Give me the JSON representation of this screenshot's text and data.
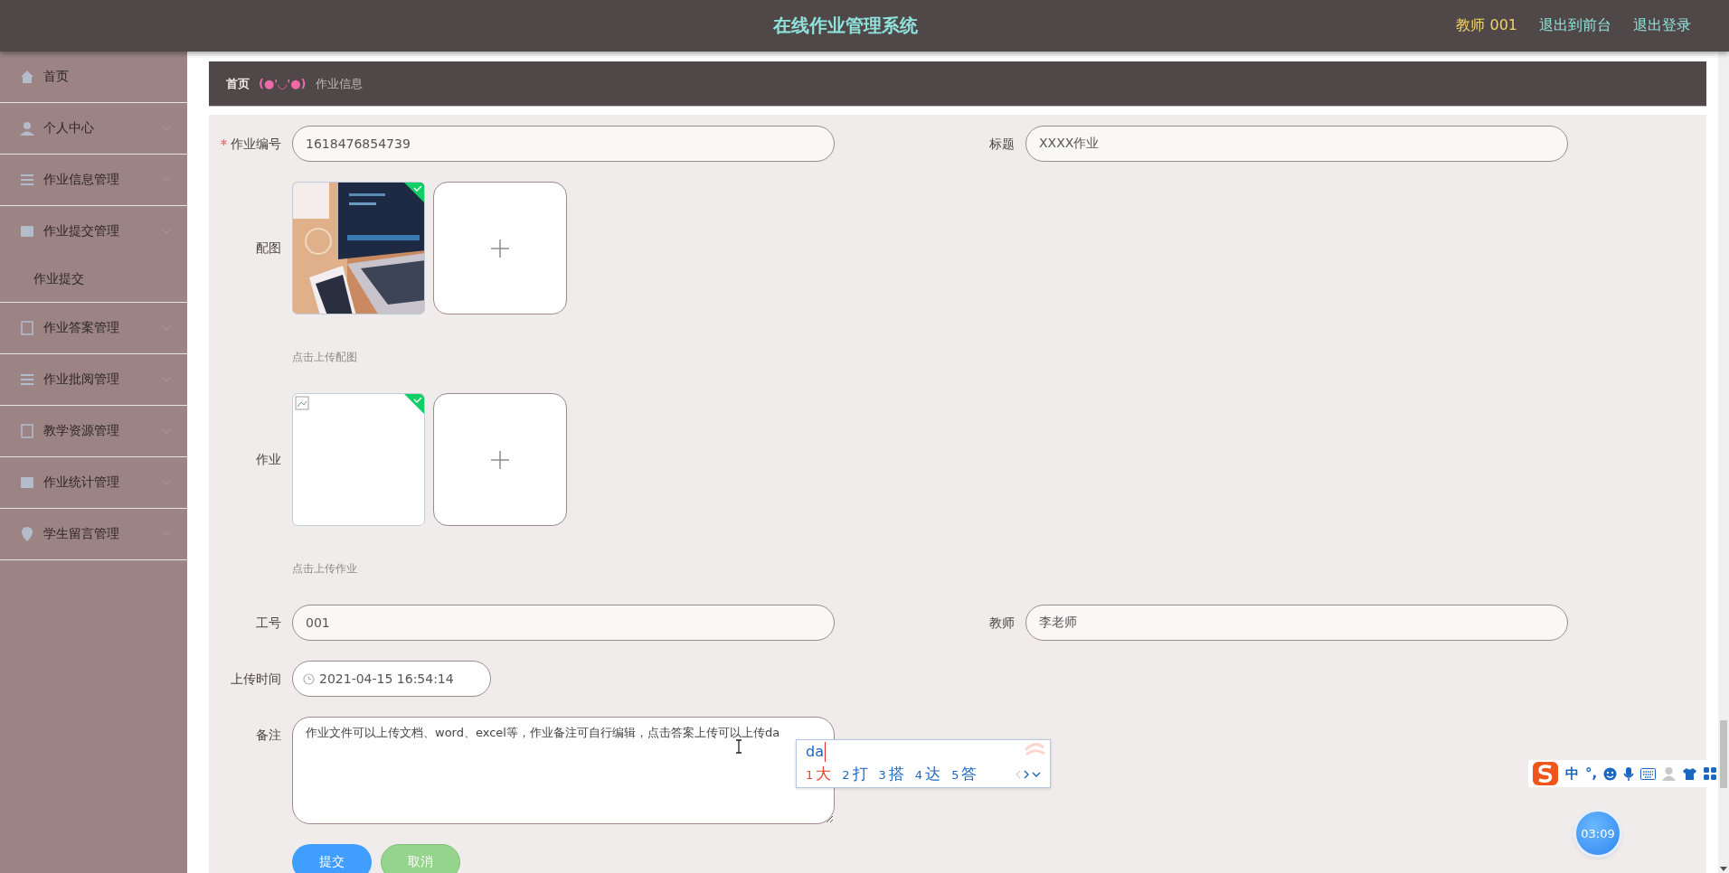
{
  "header": {
    "title": "在线作业管理系统",
    "user": "教师 001",
    "links": [
      "退出到前台",
      "退出登录"
    ]
  },
  "sidebar": {
    "items": [
      {
        "label": "首页",
        "kind": "home",
        "expandable": false
      },
      {
        "label": "个人中心",
        "kind": "user",
        "expandable": true
      },
      {
        "label": "作业信息管理",
        "kind": "list",
        "expandable": true
      },
      {
        "label": "作业提交管理",
        "kind": "card",
        "expandable": true,
        "children": [
          {
            "label": "作业提交"
          }
        ]
      },
      {
        "label": "作业答案管理",
        "kind": "doc",
        "expandable": true
      },
      {
        "label": "作业批阅管理",
        "kind": "list",
        "expandable": true
      },
      {
        "label": "教学资源管理",
        "kind": "doc",
        "expandable": true
      },
      {
        "label": "作业统计管理",
        "kind": "card",
        "expandable": true
      },
      {
        "label": "学生留言管理",
        "kind": "pin",
        "expandable": true
      }
    ]
  },
  "breadcrumb": {
    "home": "首页",
    "separator": "(●'◡'●)",
    "current": "作业信息"
  },
  "form": {
    "rows": [
      [
        {
          "kind": "text",
          "label": "作业编号",
          "required": true,
          "value": "1618476854739"
        },
        {
          "kind": "text",
          "label": "标题",
          "required": false,
          "value": "XXXX作业"
        }
      ],
      [
        {
          "kind": "upload",
          "label": "配图",
          "required": false,
          "files": [
            {
              "kind": "picture",
              "done": true
            }
          ],
          "hint": "点击上传配图"
        }
      ],
      [
        {
          "kind": "upload",
          "label": "作业",
          "required": false,
          "files": [
            {
              "kind": "broken",
              "done": true
            }
          ],
          "hint": "点击上传作业"
        }
      ],
      [
        {
          "kind": "text",
          "label": "工号",
          "required": false,
          "value": "001"
        },
        {
          "kind": "text",
          "label": "教师",
          "required": false,
          "value": "李老师"
        }
      ],
      [
        {
          "kind": "date",
          "label": "上传时间",
          "required": false,
          "value": "2021-04-15 16:54:14"
        }
      ],
      [
        {
          "kind": "textarea",
          "label": "备注",
          "required": false,
          "value": "作业文件可以上传文档、word、excel等，作业备注可自行编辑，点击答案上传可以上传da"
        }
      ]
    ],
    "buttons": [
      {
        "label": "提交",
        "kind": "primary"
      },
      {
        "label": "取消",
        "kind": "success"
      }
    ]
  },
  "ime": {
    "composition": "da",
    "candidates": [
      {
        "number": "1",
        "text": "大",
        "selected": true
      },
      {
        "number": "2",
        "text": "打",
        "selected": false
      },
      {
        "number": "3",
        "text": "搭",
        "selected": false
      },
      {
        "number": "4",
        "text": "达",
        "selected": false
      },
      {
        "number": "5",
        "text": "答",
        "selected": false
      }
    ]
  },
  "ime_toolbar": {
    "mode": "中",
    "punctuation": "°,"
  },
  "timer": "03:09"
}
